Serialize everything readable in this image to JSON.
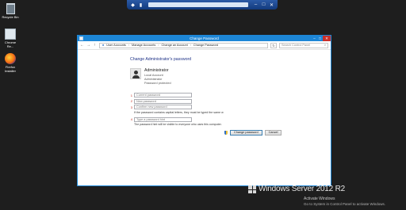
{
  "desktop": {
    "icons": [
      {
        "label": "Recycle Bin",
        "icon": "recycle-bin-icon"
      },
      {
        "label": "Chrome Re...",
        "icon": "chrome-remote-icon"
      },
      {
        "label": "Firefox Installer",
        "icon": "firefox-icon"
      }
    ]
  },
  "window": {
    "title": "Change Password",
    "controls": {
      "minimize": "–",
      "maximize": "□",
      "close": "✕"
    }
  },
  "nav": {
    "back": "←",
    "forward": "→",
    "up": "↑",
    "breadcrumb": [
      "User Accounts",
      "Manage Accounts",
      "Change an Account",
      "Change Password"
    ],
    "refresh": "↻",
    "search_placeholder": "Search Control Panel"
  },
  "page": {
    "heading": "Change Administrator's password",
    "user": {
      "name": "Administrator",
      "lines": [
        "Local Account",
        "Administrator",
        "Password protected"
      ]
    },
    "fields": {
      "current": "Current password",
      "new": "New password",
      "confirm": "Confirm new password",
      "hint": "Type a password hint"
    },
    "case_note": "If the password contains capital letters, they must be typed the same w",
    "hint_note": "The password hint will be visible to everyone who uses this computer.",
    "buttons": {
      "change": "Change password",
      "cancel": "Cancel"
    }
  },
  "watermark": {
    "title": "Windows Server 2012 R2",
    "activate": "Activate Windows",
    "subtext": "Go to System in Control Panel to activate Windows."
  }
}
